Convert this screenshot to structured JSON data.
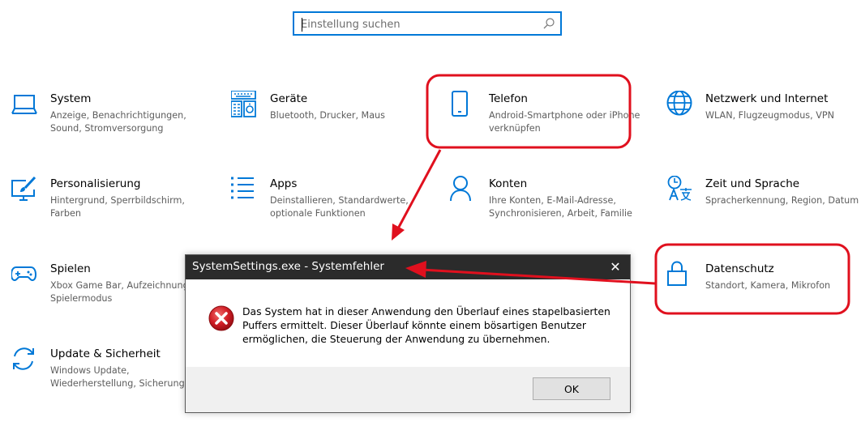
{
  "search": {
    "placeholder": "Einstellung suchen"
  },
  "tiles": [
    {
      "title": "System",
      "desc": "Anzeige, Benachrichtigungen, Sound, Stromversorgung",
      "icon": "laptop-icon"
    },
    {
      "title": "Geräte",
      "desc": "Bluetooth, Drucker, Maus",
      "icon": "devices-icon"
    },
    {
      "title": "Telefon",
      "desc": "Android-Smartphone oder iPhone verknüpfen",
      "icon": "phone-icon"
    },
    {
      "title": "Netzwerk und Internet",
      "desc": "WLAN, Flugzeugmodus, VPN",
      "icon": "globe-icon"
    },
    {
      "title": "Personalisierung",
      "desc": "Hintergrund, Sperrbildschirm, Farben",
      "icon": "paint-icon"
    },
    {
      "title": "Apps",
      "desc": "Deinstallieren, Standardwerte, optionale Funktionen",
      "icon": "apps-list-icon"
    },
    {
      "title": "Konten",
      "desc": "Ihre Konten, E-Mail-Adresse, Synchronisieren, Arbeit, Familie",
      "icon": "person-icon"
    },
    {
      "title": "Zeit und Sprache",
      "desc": "Spracherkennung, Region, Datum",
      "icon": "time-language-icon"
    },
    {
      "title": "Spielen",
      "desc": "Xbox Game Bar, Aufzeichnungen, Spielermodus",
      "icon": "gamepad-icon"
    },
    {
      "title": "Datenschutz",
      "desc": "Standort, Kamera, Mikrofon",
      "icon": "lock-icon"
    },
    {
      "title": "Update & Sicherheit",
      "desc": "Windows Update, Wiederherstellung, Sicherung",
      "icon": "update-icon"
    }
  ],
  "dialog": {
    "title": "SystemSettings.exe - Systemfehler",
    "close_label": "✕",
    "message": "Das System hat in dieser Anwendung den Überlauf eines stapelbasierten Puffers ermittelt. Dieser Überlauf könnte einem bösartigen Benutzer ermöglichen, die Steuerung der Anwendung zu übernehmen.",
    "ok_label": "OK",
    "icon": "error-icon"
  },
  "colors": {
    "accent": "#0078d7",
    "annotation": "#e0101e",
    "titlebar": "#2b2b2b",
    "error": "#c8141e"
  }
}
